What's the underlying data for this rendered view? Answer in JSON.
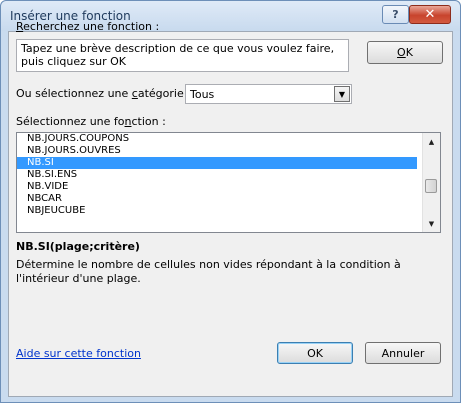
{
  "window": {
    "title": "Insérer une fonction",
    "help_glyph": "?",
    "close_glyph": "✕"
  },
  "search": {
    "label_prefix": "",
    "label_hotkey": "R",
    "label_rest": "echerchez une fonction :",
    "value": "Tapez une brève description de ce que vous voulez faire, puis cliquez sur OK",
    "go_hotkey": "O",
    "go_rest": "K"
  },
  "category": {
    "label_prefix": "Ou sélectionnez une ",
    "label_hotkey": "c",
    "label_rest": "atégorie :",
    "selected": "Tous",
    "arrow_glyph": "▼"
  },
  "functions": {
    "label_prefix": "Sélectionnez une fo",
    "label_hotkey": "n",
    "label_rest": "ction :",
    "items": [
      "NB.JOURS.COUPONS",
      "NB.JOURS.OUVRES",
      "NB.SI",
      "NB.SI.ENS",
      "NB.VIDE",
      "NBCAR",
      "NBJEUCUBE"
    ],
    "selected_index": 2,
    "scroll_up_glyph": "▲",
    "scroll_down_glyph": "▼"
  },
  "detail": {
    "signature": "NB.SI(plage;critère)",
    "description": "Détermine le nombre de cellules non vides répondant à la condition à l'intérieur d'une plage."
  },
  "footer": {
    "help_link": "Aide sur cette fonction",
    "ok_label": "OK",
    "cancel_label": "Annuler"
  },
  "colors": {
    "selection": "#3399ff",
    "link": "#0033cc",
    "close_button": "#c8442d"
  }
}
